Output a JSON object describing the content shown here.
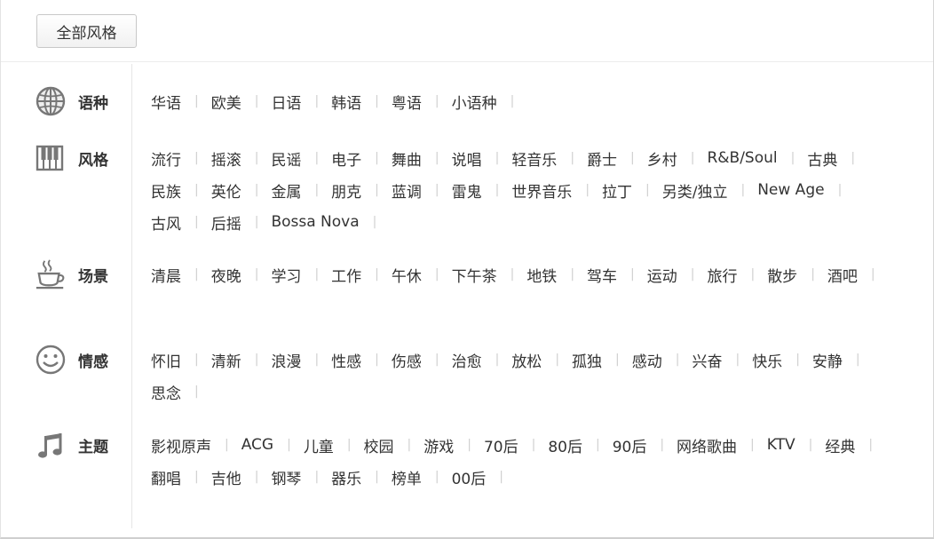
{
  "all_styles_label": "全部风格",
  "categories": [
    {
      "key": "language",
      "title": "语种",
      "icon": "globe-icon",
      "tags": [
        "华语",
        "欧美",
        "日语",
        "韩语",
        "粤语",
        "小语种"
      ]
    },
    {
      "key": "style",
      "title": "风格",
      "icon": "piano-icon",
      "tags": [
        "流行",
        "摇滚",
        "民谣",
        "电子",
        "舞曲",
        "说唱",
        "轻音乐",
        "爵士",
        "乡村",
        "R&B/Soul",
        "古典",
        "民族",
        "英伦",
        "金属",
        "朋克",
        "蓝调",
        "雷鬼",
        "世界音乐",
        "拉丁",
        "另类/独立",
        "New Age",
        "古风",
        "后摇",
        "Bossa Nova"
      ]
    },
    {
      "key": "scene",
      "title": "场景",
      "icon": "coffee-cup-icon",
      "tags": [
        "清晨",
        "夜晚",
        "学习",
        "工作",
        "午休",
        "下午茶",
        "地铁",
        "驾车",
        "运动",
        "旅行",
        "散步",
        "酒吧"
      ]
    },
    {
      "key": "emotion",
      "title": "情感",
      "icon": "smiley-icon",
      "tags": [
        "怀旧",
        "清新",
        "浪漫",
        "性感",
        "伤感",
        "治愈",
        "放松",
        "孤独",
        "感动",
        "兴奋",
        "快乐",
        "安静",
        "思念"
      ]
    },
    {
      "key": "theme",
      "title": "主题",
      "icon": "music-note-icon",
      "tags": [
        "影视原声",
        "ACG",
        "儿童",
        "校园",
        "游戏",
        "70后",
        "80后",
        "90后",
        "网络歌曲",
        "KTV",
        "经典",
        "翻唱",
        "吉他",
        "钢琴",
        "器乐",
        "榜单",
        "00后"
      ]
    }
  ],
  "colors": {
    "text": "#333333",
    "icon": "#666666",
    "separator": "#d0d0d0"
  }
}
